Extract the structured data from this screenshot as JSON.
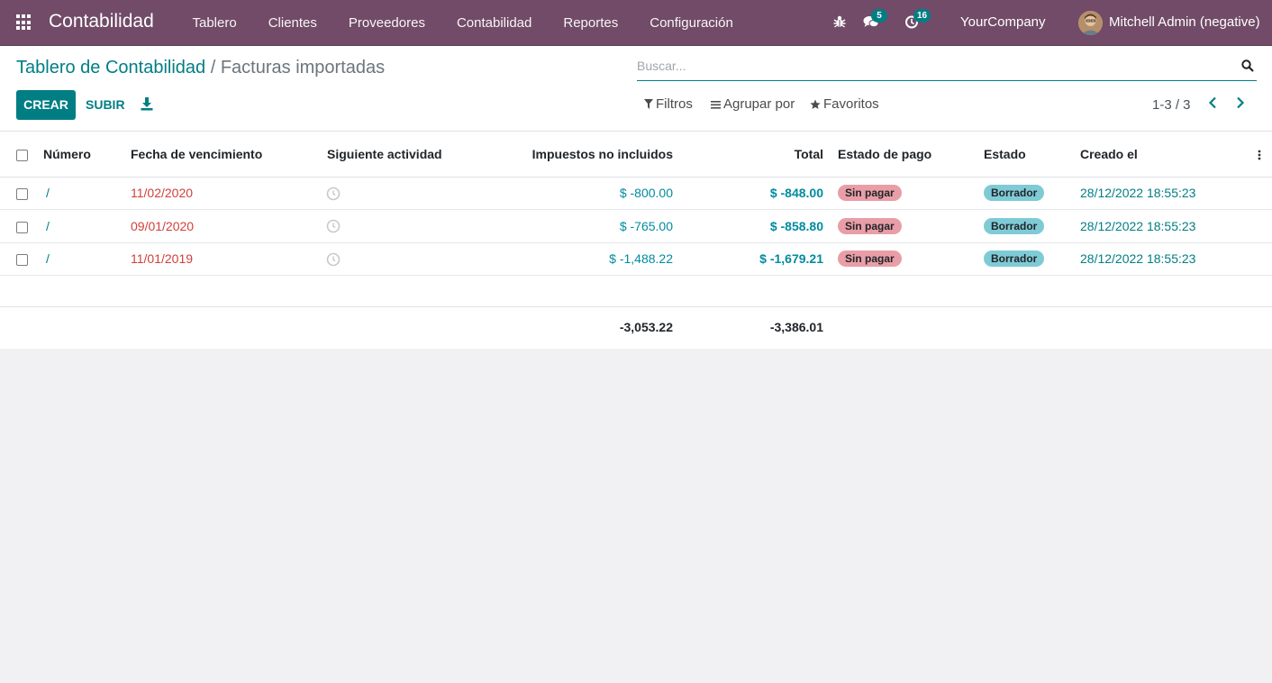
{
  "navbar": {
    "brand": "Contabilidad",
    "menu": [
      "Tablero",
      "Clientes",
      "Proveedores",
      "Contabilidad",
      "Reportes",
      "Configuración"
    ],
    "messages_count": "5",
    "activities_count": "16",
    "company": "YourCompany",
    "user": "Mitchell Admin (negative)"
  },
  "breadcrumb": {
    "parent": "Tablero de Contabilidad",
    "separator": " / ",
    "current": "Facturas importadas"
  },
  "buttons": {
    "create": "CREAR",
    "upload": "SUBIR"
  },
  "search": {
    "placeholder": "Buscar..."
  },
  "filters": {
    "filters": "Filtros",
    "group_by": "Agrupar por",
    "favorites": "Favoritos"
  },
  "pager": {
    "value": "1-3 / 3"
  },
  "table": {
    "headers": {
      "number": "Número",
      "due_date": "Fecha de vencimiento",
      "next_activity": "Siguiente actividad",
      "untaxed": "Impuestos no incluidos",
      "total": "Total",
      "payment_state": "Estado de pago",
      "state": "Estado",
      "created": "Creado el"
    },
    "rows": [
      {
        "number": "/",
        "due_date": "11/02/2020",
        "untaxed": "$ -800.00",
        "total": "$ -848.00",
        "payment_state": "Sin pagar",
        "state": "Borrador",
        "created": "28/12/2022 18:55:23"
      },
      {
        "number": "/",
        "due_date": "09/01/2020",
        "untaxed": "$ -765.00",
        "total": "$ -858.80",
        "payment_state": "Sin pagar",
        "state": "Borrador",
        "created": "28/12/2022 18:55:23"
      },
      {
        "number": "/",
        "due_date": "11/01/2019",
        "untaxed": "$ -1,488.22",
        "total": "$ -1,679.21",
        "payment_state": "Sin pagar",
        "state": "Borrador",
        "created": "28/12/2022 18:55:23"
      }
    ],
    "totals": {
      "untaxed": "-3,053.22",
      "total": "-3,386.01"
    }
  },
  "colors": {
    "navbar": "#714b67",
    "primary": "#017e84",
    "overdue": "#d23f3a",
    "badge_unpaid": "#e99ea7",
    "badge_draft": "#7ecbd6"
  }
}
